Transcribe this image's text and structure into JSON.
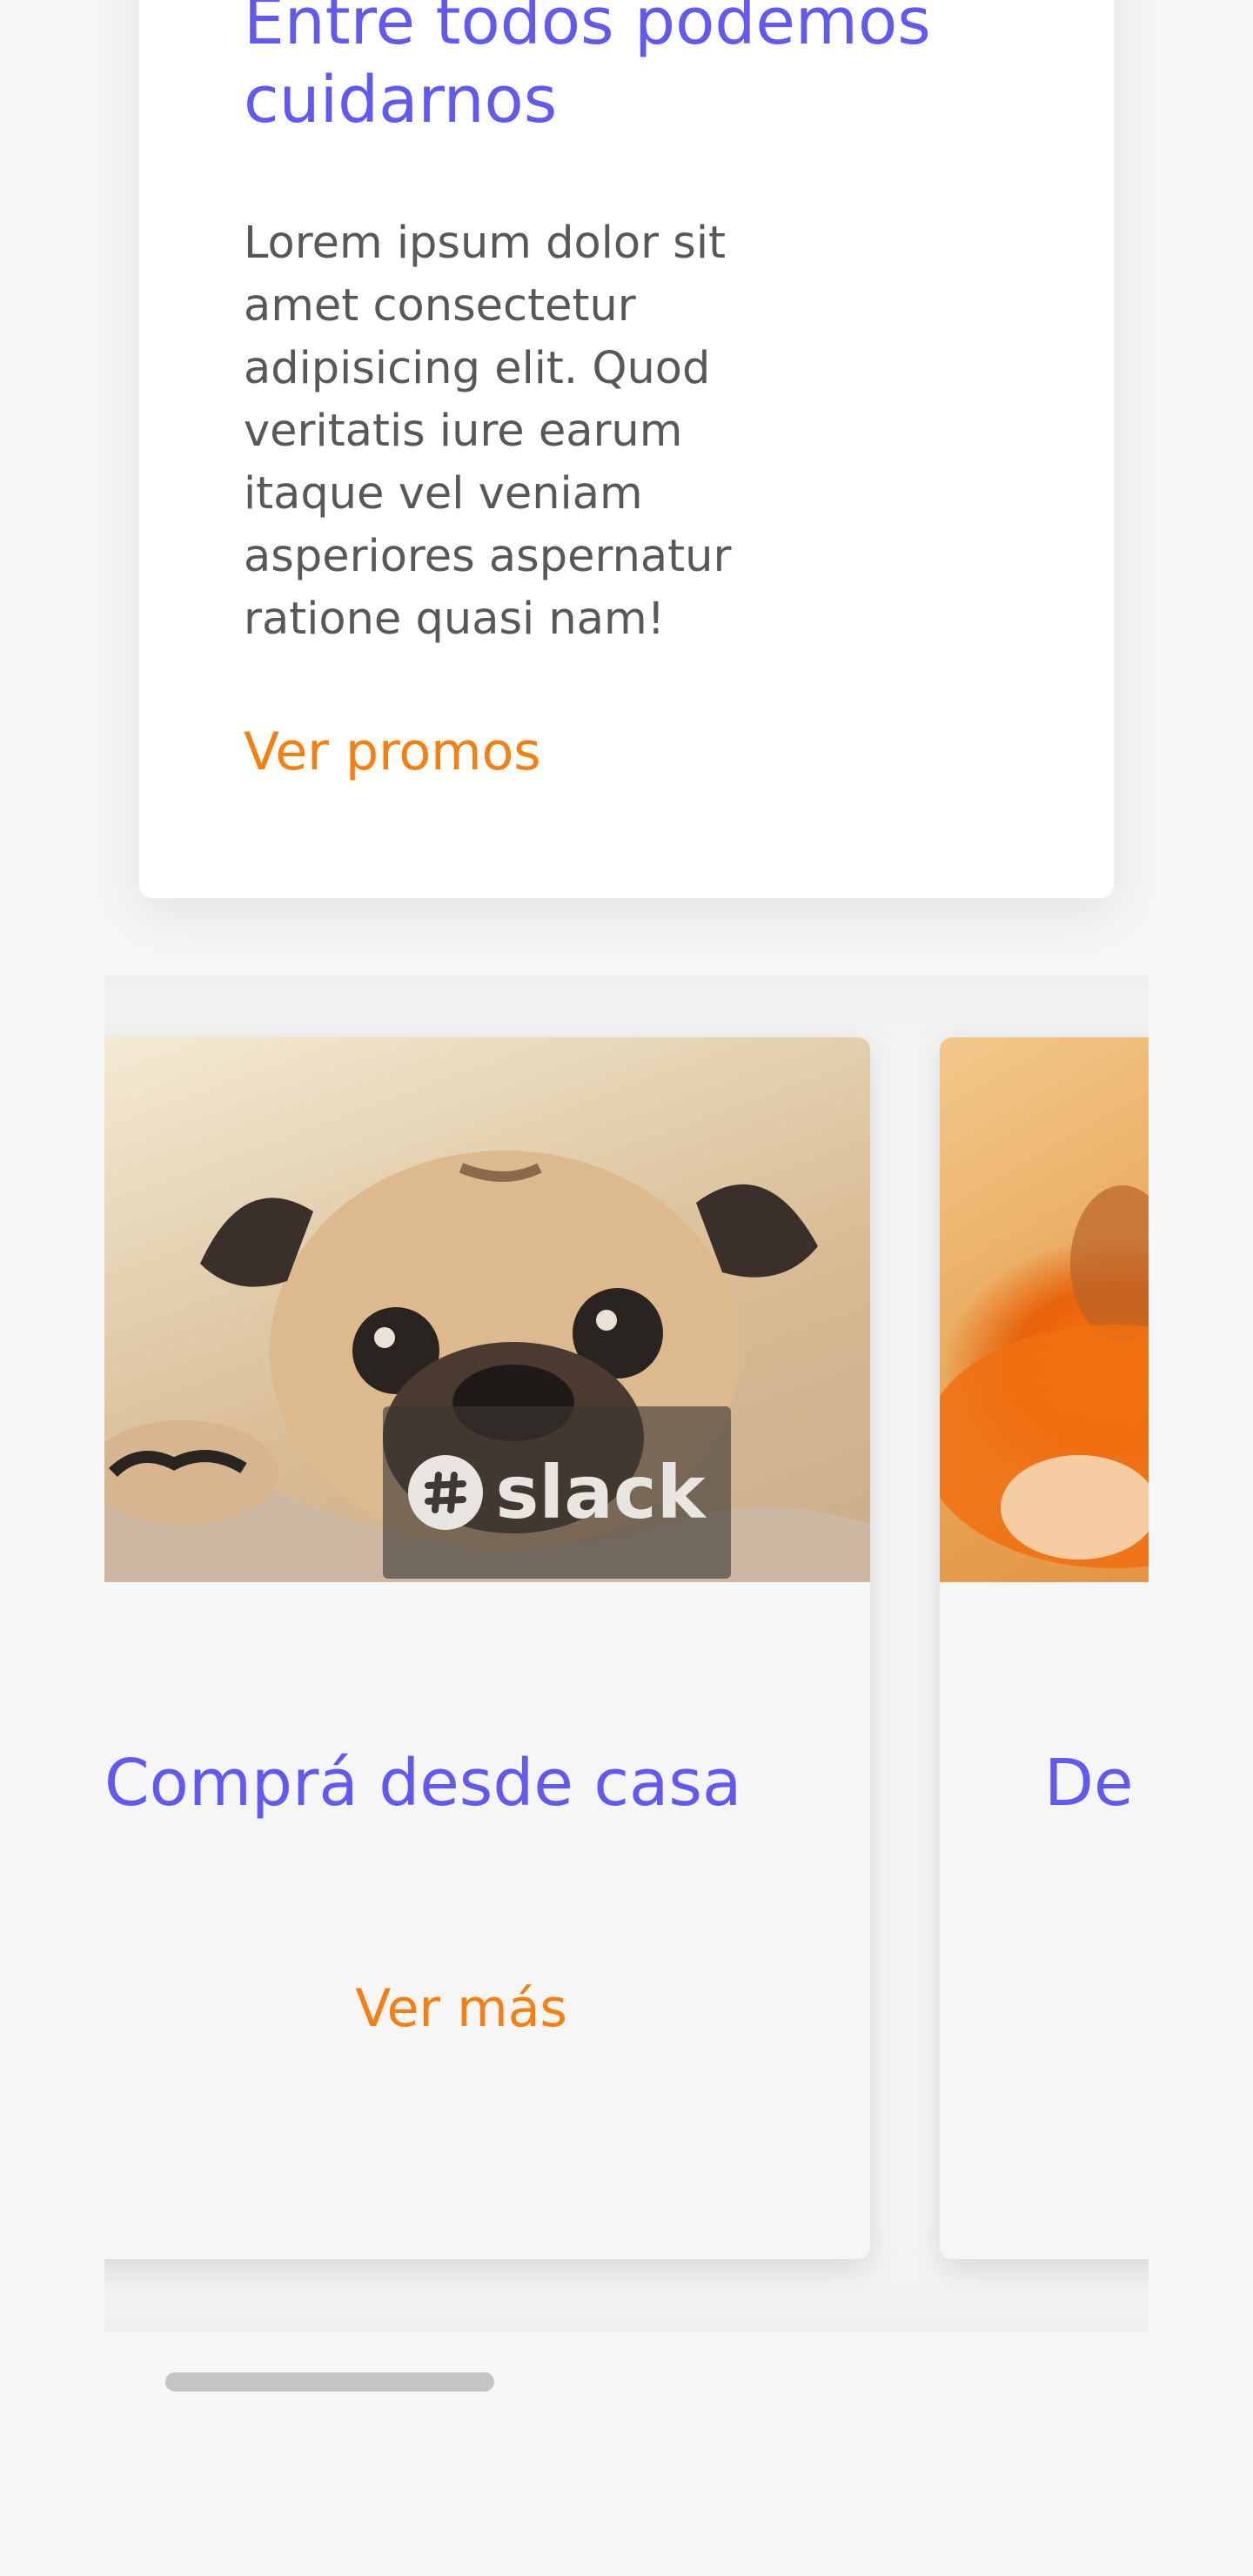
{
  "promo": {
    "title": "Entre todos podemos cuidarnos",
    "body": "Lorem ipsum dolor sit amet consectetur adipisicing elit. Quod veritatis iure earum itaque vel veniam asperiores aspernatur ratione quasi nam!",
    "link_label": "Ver promos"
  },
  "carousel": {
    "slides": [
      {
        "title": "Comprá desde casa",
        "link_label": "Ver más",
        "image_overlay_text": "slack"
      },
      {
        "title": "De",
        "link_label": ""
      }
    ],
    "scroll_position": 0.0
  },
  "colors": {
    "heading": "#6159f2",
    "link": "#f77f0f",
    "body_text": "#585858",
    "page_background": "#f6f6f6",
    "card_background": "#ffffff"
  },
  "icons": {
    "slack_logo": "slack-logo-icon"
  }
}
